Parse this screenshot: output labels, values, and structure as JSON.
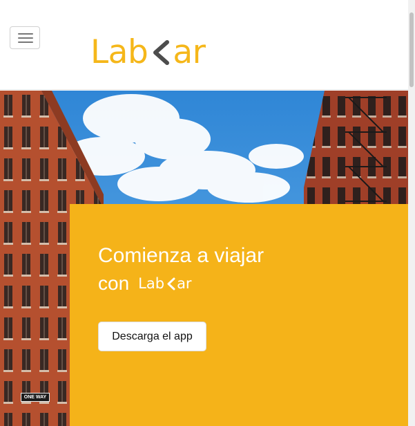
{
  "header": {
    "menu_label": "Toggle navigation",
    "logo": {
      "part1": "Lab",
      "part2": "ar",
      "accent_color": "#f5b71a",
      "chevron_color": "#4d4d4d"
    }
  },
  "hero": {
    "title": "Comienza a viajar",
    "subtitle_prefix": "con",
    "mini_logo": {
      "part1": "Lab",
      "part2": "ar"
    },
    "download_button": "Descarga el app",
    "street_sign": "ONE WAY",
    "panel_color": "#f5b319"
  }
}
